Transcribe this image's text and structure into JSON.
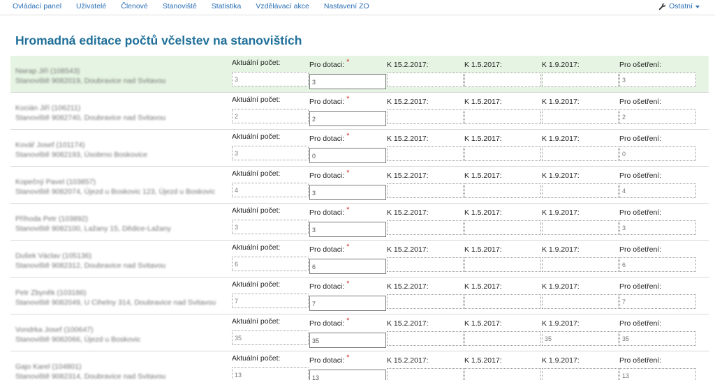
{
  "nav": {
    "items": [
      "Ovládací panel",
      "Uživatelé",
      "Členové",
      "Stanoviště",
      "Statistika",
      "Vzdělávací akce",
      "Nastavení ZO"
    ],
    "right_label": "Ostatní"
  },
  "page_title": "Hromadná editace počtů včelstev na stanovištích",
  "columns": {
    "actual": "Aktuální počet:",
    "subsidy": "Pro dotaci:",
    "required_mark": "*",
    "d1": "K 15.2.2017:",
    "d2": "K 1.5.2017:",
    "d3": "K 1.9.2017:",
    "treatment": "Pro ošetření:"
  },
  "rows": [
    {
      "name": "Nwrap Jiří (108543)",
      "site": "Stanoviště 9082019, Doubravice nad Svitavou",
      "actual": "3",
      "subsidy": "3",
      "d1": "",
      "d2": "",
      "d3": "",
      "treatment": "3"
    },
    {
      "name": "Kocián Jiří (106211)",
      "site": "Stanoviště 9082740, Doubravice nad Svitavou",
      "actual": "2",
      "subsidy": "2",
      "d1": "",
      "d2": "",
      "d3": "",
      "treatment": "2"
    },
    {
      "name": "Kovář Josef (101174)",
      "site": "Stanoviště 9082193, Úsobrno Boskovice",
      "actual": "3",
      "subsidy": "0",
      "d1": "",
      "d2": "",
      "d3": "",
      "treatment": "0"
    },
    {
      "name": "Kopečný Pavel (103857)",
      "site": "Stanoviště 9082074, Újezd u Boskovic 123, Újezd u Boskovic",
      "actual": "4",
      "subsidy": "3",
      "d1": "",
      "d2": "",
      "d3": "",
      "treatment": "4"
    },
    {
      "name": "Příhoda Petr (103892)",
      "site": "Stanoviště 9082100, Lažany 15, Dědice-Lažany",
      "actual": "3",
      "subsidy": "3",
      "d1": "",
      "d2": "",
      "d3": "",
      "treatment": "3"
    },
    {
      "name": "Dušek Václav (105136)",
      "site": "Stanoviště 9082312, Doubravice nad Svitavou",
      "actual": "6",
      "subsidy": "6",
      "d1": "",
      "d2": "",
      "d3": "",
      "treatment": "6"
    },
    {
      "name": "Petr Zbyněk (103186)",
      "site": "Stanoviště 9082049, U Cihelny 314, Doubravice nad Svitavou",
      "actual": "7",
      "subsidy": "7",
      "d1": "",
      "d2": "",
      "d3": "",
      "treatment": "7"
    },
    {
      "name": "Vondrka Josef (100647)",
      "site": "Stanoviště 9082066, Újezd u Boskovic",
      "actual": "35",
      "subsidy": "35",
      "d1": "",
      "d2": "",
      "d3": "35",
      "treatment": "35"
    },
    {
      "name": "Gajo Karel (104801)",
      "site": "Stanoviště 9082314, Doubravice nad Svitavou",
      "actual": "13",
      "subsidy": "13",
      "d1": "",
      "d2": "",
      "d3": "",
      "treatment": "13"
    }
  ],
  "colors": {
    "link": "#2a6fb5",
    "title": "#1f6f99",
    "highlight_row": "#e6f5e3",
    "required": "#c9302c"
  }
}
